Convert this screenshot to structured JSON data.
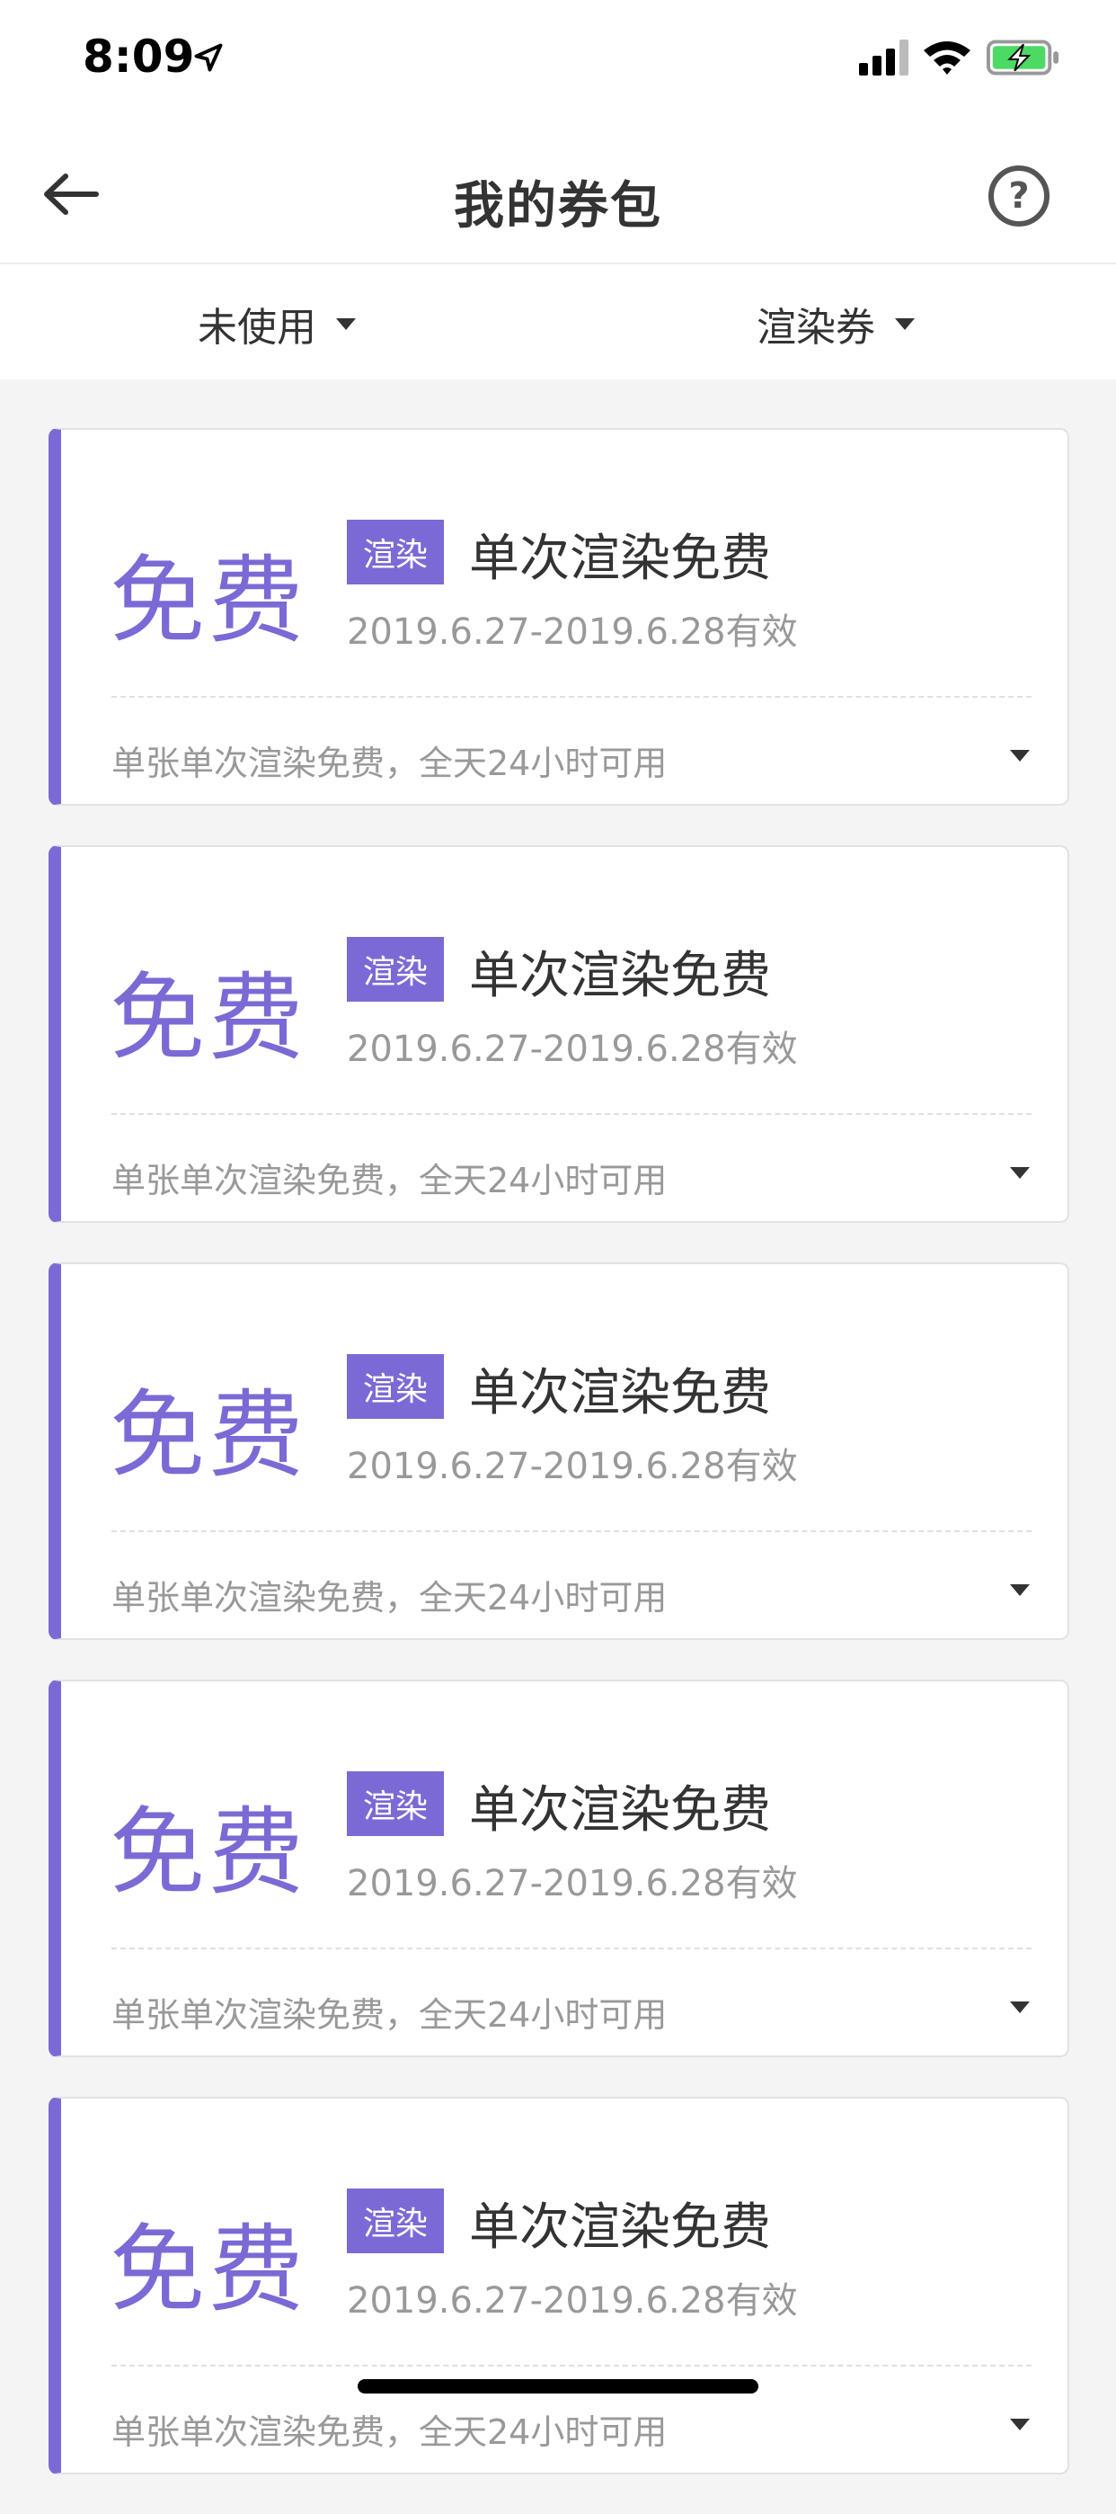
{
  "status_bar": {
    "time": "8:09"
  },
  "nav": {
    "title": "我的券包",
    "help_label": "?"
  },
  "filters": {
    "status": "未使用",
    "type": "渲染券"
  },
  "coupons": [
    {
      "amount": "免费",
      "tag": "渲染",
      "name": "单次渲染免费",
      "validity": "2019.6.27-2019.6.28有效",
      "description": "单张单次渲染免费，全天24小时可用"
    },
    {
      "amount": "免费",
      "tag": "渲染",
      "name": "单次渲染免费",
      "validity": "2019.6.27-2019.6.28有效",
      "description": "单张单次渲染免费，全天24小时可用"
    },
    {
      "amount": "免费",
      "tag": "渲染",
      "name": "单次渲染免费",
      "validity": "2019.6.27-2019.6.28有效",
      "description": "单张单次渲染免费，全天24小时可用"
    },
    {
      "amount": "免费",
      "tag": "渲染",
      "name": "单次渲染免费",
      "validity": "2019.6.27-2019.6.28有效",
      "description": "单张单次渲染免费，全天24小时可用"
    },
    {
      "amount": "免费",
      "tag": "渲染",
      "name": "单次渲染免费",
      "validity": "2019.6.27-2019.6.28有效",
      "description": "单张单次渲染免费，全天24小时可用"
    }
  ],
  "colors": {
    "accent": "#7b6ad5",
    "battery": "#4cd964"
  }
}
